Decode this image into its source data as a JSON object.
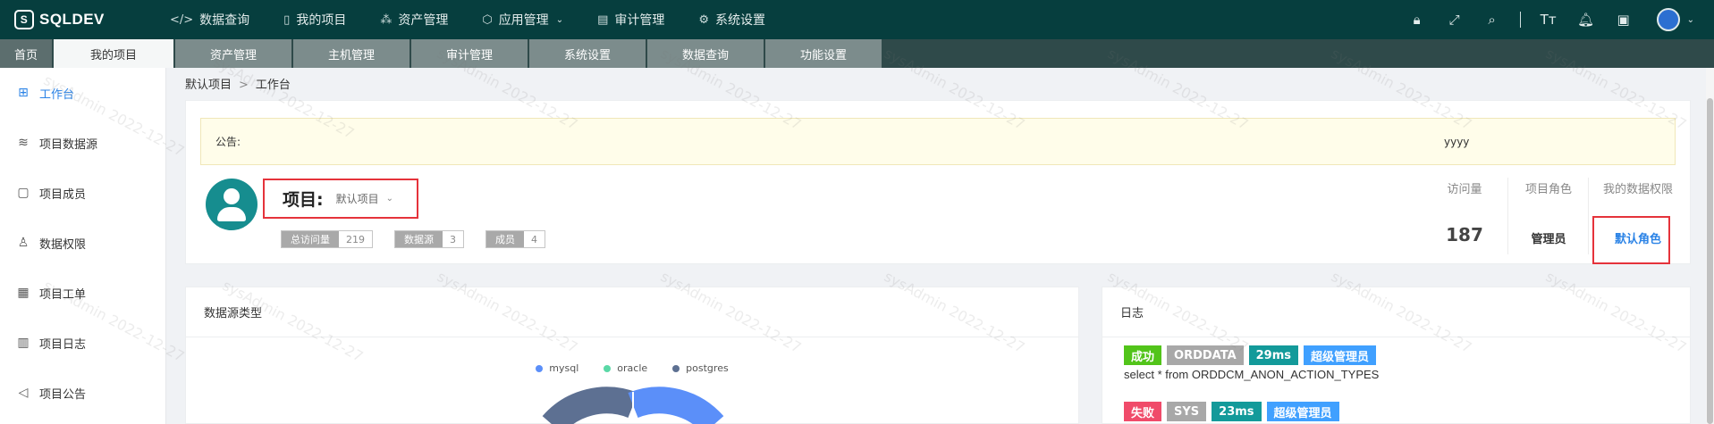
{
  "app": {
    "logo": "SQLDEV"
  },
  "topnav": [
    {
      "label": "数据查询",
      "icon": "code-icon"
    },
    {
      "label": "我的项目",
      "icon": "folder-icon"
    },
    {
      "label": "资产管理",
      "icon": "cluster-icon"
    },
    {
      "label": "应用管理",
      "icon": "cube-icon",
      "caret": "⌄"
    },
    {
      "label": "审计管理",
      "icon": "audit-icon"
    },
    {
      "label": "系统设置",
      "icon": "gear-icon"
    }
  ],
  "tabs": [
    "首页",
    "我的项目",
    "资产管理",
    "主机管理",
    "审计管理",
    "系统设置",
    "数据查询",
    "功能设置"
  ],
  "sidebar": [
    {
      "label": "工作台",
      "active": true
    },
    {
      "label": "项目数据源"
    },
    {
      "label": "项目成员"
    },
    {
      "label": "数据权限"
    },
    {
      "label": "项目工单"
    },
    {
      "label": "项目日志"
    },
    {
      "label": "项目公告"
    }
  ],
  "breadcrumb": {
    "root": "默认项目",
    "sep": ">",
    "current": "工作台"
  },
  "notice": {
    "label": "公告:",
    "text": "yyyy"
  },
  "project": {
    "title_label": "项目:",
    "name": "默认项目",
    "stats": [
      {
        "label": "总访问量",
        "value": "219"
      },
      {
        "label": "数据源",
        "value": "3"
      },
      {
        "label": "成员",
        "value": "4"
      }
    ],
    "right_stats": {
      "visits": {
        "label": "访问量",
        "value": "187"
      },
      "role": {
        "label": "项目角色",
        "value": "管理员"
      },
      "perm": {
        "label": "我的数据权限",
        "value": "默认角色"
      }
    }
  },
  "datasource_card": {
    "title": "数据源类型",
    "legend": [
      {
        "name": "mysql",
        "color": "#5b8ff9"
      },
      {
        "name": "oracle",
        "color": "#5ad8a6"
      },
      {
        "name": "postgres",
        "color": "#5d7092"
      }
    ]
  },
  "log_card": {
    "title": "日志",
    "entries": [
      {
        "tags": [
          {
            "text": "成功",
            "color": "#52c41a"
          },
          {
            "text": "ORDDATA",
            "color": "#a8a8a8"
          },
          {
            "text": "29ms",
            "color": "#139a9a"
          },
          {
            "text": "超级管理员",
            "color": "#40a0ff"
          }
        ],
        "sql": "select * from ORDDCM_ANON_ACTION_TYPES"
      },
      {
        "tags": [
          {
            "text": "失败",
            "color": "#f04b6a"
          },
          {
            "text": "SYS",
            "color": "#a8a8a8"
          },
          {
            "text": "23ms",
            "color": "#139a9a"
          },
          {
            "text": "超级管理员",
            "color": "#40a0ff"
          }
        ],
        "sql": ""
      }
    ]
  },
  "watermark": "sysAdmin 2022-12-27",
  "colors": {
    "topbar": "#063e3e",
    "accent": "#2b83e6",
    "highlight": "#e5333b",
    "teal": "#168d8f"
  }
}
